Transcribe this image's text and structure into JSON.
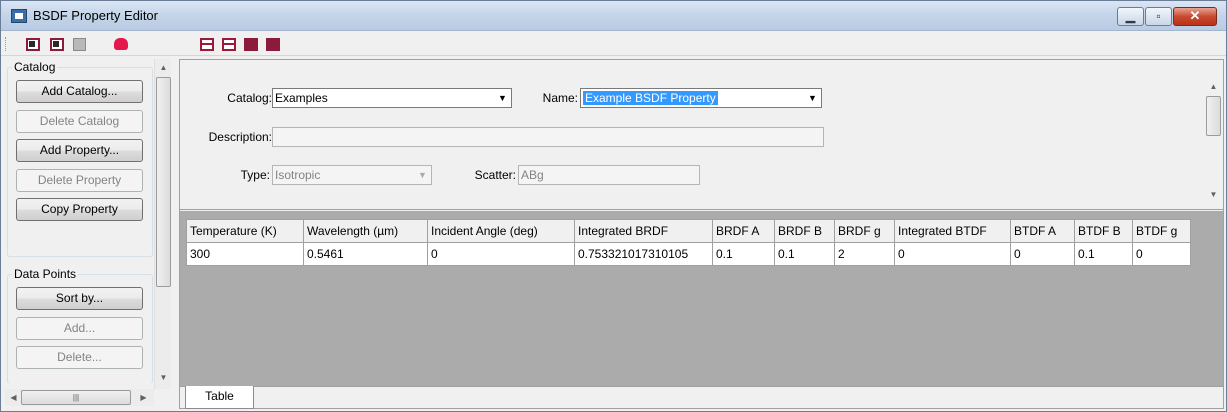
{
  "window": {
    "title": "BSDF Property Editor"
  },
  "toolbar": {
    "icons": [
      "export-icon",
      "import-icon",
      "save-icon",
      "debug-icon",
      "table-view-icon",
      "split-view-icon",
      "move-down-icon",
      "move-up-icon"
    ]
  },
  "sidebar": {
    "catalog_group": "Catalog",
    "add_catalog": "Add Catalog...",
    "delete_catalog": "Delete Catalog",
    "add_property": "Add Property...",
    "delete_property": "Delete Property",
    "copy_property": "Copy Property",
    "data_points_group": "Data Points",
    "sort_by": "Sort by...",
    "add": "Add...",
    "delete": "Delete..."
  },
  "form": {
    "catalog_label": "Catalog:",
    "catalog_value": "Examples",
    "name_label": "Name:",
    "name_value": "Example BSDF Property",
    "description_label": "Description:",
    "description_value": "",
    "type_label": "Type:",
    "type_value": "Isotropic",
    "scatter_label": "Scatter:",
    "scatter_value": "ABg"
  },
  "table": {
    "columns": [
      "Temperature (K)",
      "Wavelength (µm)",
      "Incident Angle (deg)",
      "Integrated BRDF",
      "BRDF A",
      "BRDF B",
      "BRDF g",
      "Integrated BTDF",
      "BTDF A",
      "BTDF B",
      "BTDF g"
    ],
    "rows": [
      [
        "300",
        "0.5461",
        "0",
        "0.753321017310105",
        "0.1",
        "0.1",
        "2",
        "0",
        "0",
        "0.1",
        "0"
      ]
    ]
  },
  "tabs": {
    "table": "Table"
  },
  "colors": {
    "selection": "#3399ff",
    "grid_background": "#ababab",
    "close_button": "#c84a30"
  }
}
